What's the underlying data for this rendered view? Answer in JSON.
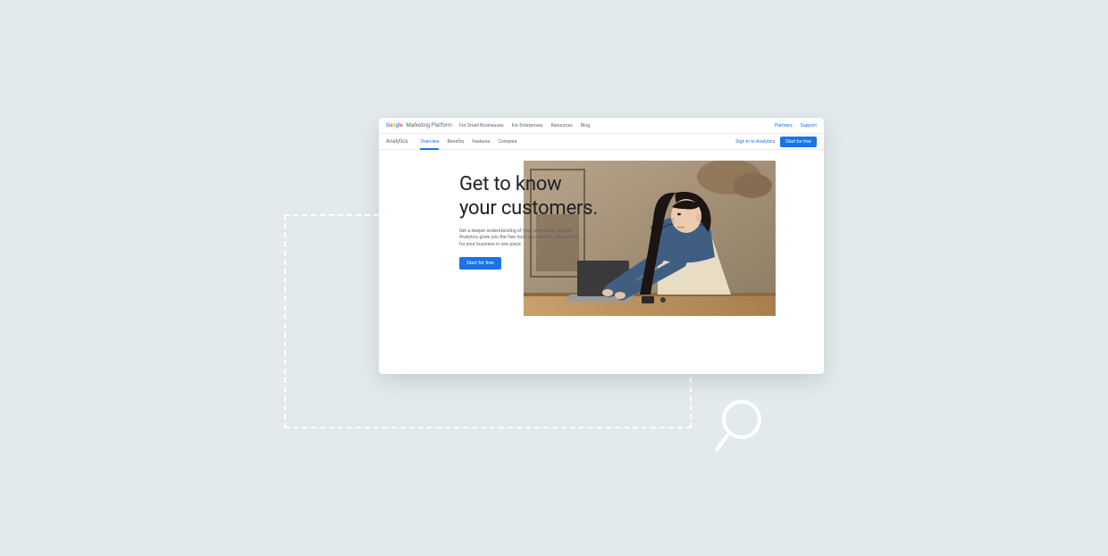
{
  "topnav": {
    "brand_platform": "Marketing Platform",
    "items": [
      "For Small Businesses",
      "For Enterprises",
      "Resources",
      "Blog"
    ],
    "right": [
      "Partners",
      "Support"
    ]
  },
  "subnav": {
    "product": "Analytics",
    "tabs": [
      {
        "label": "Overview",
        "active": true
      },
      {
        "label": "Benefits",
        "active": false
      },
      {
        "label": "Features",
        "active": false
      },
      {
        "label": "Compare",
        "active": false
      }
    ],
    "signin": "Sign in to Analytics",
    "cta": "Start for free"
  },
  "hero": {
    "title": "Get to know your customers.",
    "subtitle": "Get a deeper understanding of your customers. Google Analytics gives you the free tools you need to analyze data for your business in one place.",
    "cta": "Start for free"
  },
  "colors": {
    "primary": "#1a73e8",
    "canvas": "#e2eaec"
  }
}
